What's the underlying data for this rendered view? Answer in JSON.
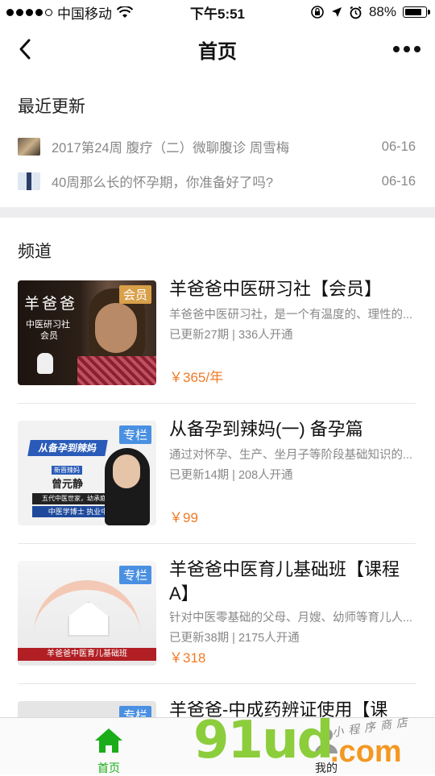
{
  "status_bar": {
    "carrier": "中国移动",
    "time": "下午5:51",
    "battery": "88%",
    "battery_level": 0.88,
    "signal_bars": 4
  },
  "nav": {
    "title": "首页",
    "back_icon": "chevron-left-icon",
    "more_icon": "more-horizontal-icon"
  },
  "recent": {
    "title": "最近更新",
    "items": [
      {
        "text": "2017第24周 腹疗（二）微聊腹诊 周雪梅",
        "date": "06-16"
      },
      {
        "text": "40周那么长的怀孕期，你准备好了吗?",
        "date": "06-16"
      }
    ]
  },
  "channels": {
    "title": "频道",
    "items": [
      {
        "tag": "会员",
        "tag_color": "#d9a04a",
        "title": "羊爸爸中医研习社【会员】",
        "desc": "羊爸爸中医研习社，是一个有温度的、理性的...",
        "stats": "已更新27期 | 336人开通",
        "price": "￥365/年",
        "cover": {
          "line1": "羊爸爸",
          "line2": "中医研习社",
          "line3": "会员"
        }
      },
      {
        "tag": "专栏",
        "tag_color": "#4a90e2",
        "title": "从备孕到辣妈(一) 备孕篇",
        "desc": "通过对怀孕、生产、坐月子等阶段基础知识的...",
        "stats": "已更新14期 | 208人开通",
        "price": "￥99",
        "cover": {
          "banner": "从备孕到辣妈",
          "small": "新晋辣妈",
          "name": "曾元静",
          "line1": "五代中医世家，幼承庭训",
          "line2": "中医学博士 执业中医师"
        }
      },
      {
        "tag": "专栏",
        "tag_color": "#4a90e2",
        "title": "羊爸爸中医育儿基础班【课程A】",
        "desc": "针对中医零基础的父母、月嫂、幼师等育儿人...",
        "stats": "已更新38期 | 2175人开通",
        "price": "￥318",
        "cover": {
          "banner": "羊爸爸中医育儿基础班"
        }
      },
      {
        "tag": "专栏",
        "tag_color": "#4a90e2",
        "title": "羊爸爸-中成药辨证使用【课",
        "desc": "",
        "stats": "",
        "price": ""
      }
    ]
  },
  "tabbar": {
    "home_label": "首页",
    "mine_label": "我的",
    "active_color": "#1aad19"
  },
  "watermark": {
    "brand": "91ud",
    "suffix": ".com",
    "tagline": "小程序商店"
  }
}
